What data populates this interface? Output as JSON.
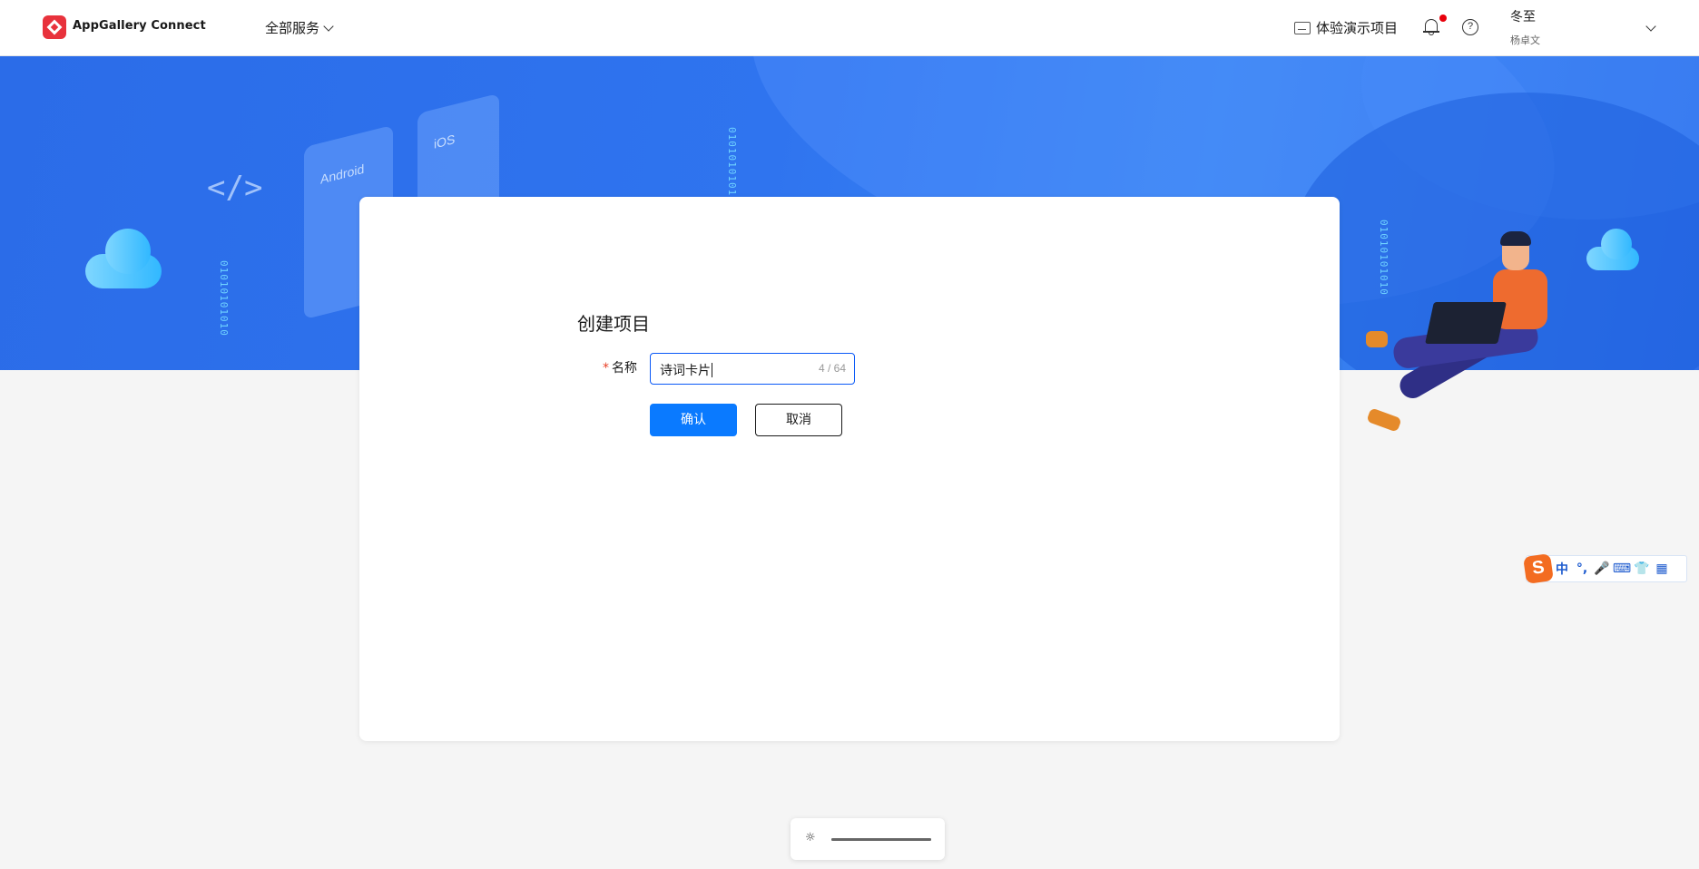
{
  "header": {
    "brand": "AppGallery Connect",
    "all_services": "全部服务",
    "demo_project": "体验演示项目",
    "help_glyph": "?",
    "user_name": "冬至",
    "user_sub": "杨卓文"
  },
  "banner": {
    "android_label": "Android",
    "ios_label": "iOS",
    "code_glyph": "</>",
    "binary_text": "01010101010"
  },
  "dialog": {
    "title": "创建项目",
    "required_mark": "*",
    "name_label": "名称",
    "name_value": "诗词卡片",
    "name_counter": "4 / 64",
    "confirm_label": "确认",
    "cancel_label": "取消"
  },
  "ime": {
    "logo": "S",
    "items": [
      "中",
      "°,",
      "🎤",
      "⌨",
      "👕",
      "▦"
    ]
  },
  "zoom": {
    "icon": "☼",
    "level": 1.0
  },
  "colors": {
    "accent": "#0a7aff",
    "input_focus": "#0a59f7",
    "notification_dot": "#e8000b",
    "banner": "#2f74ef",
    "required": "#e84026"
  }
}
